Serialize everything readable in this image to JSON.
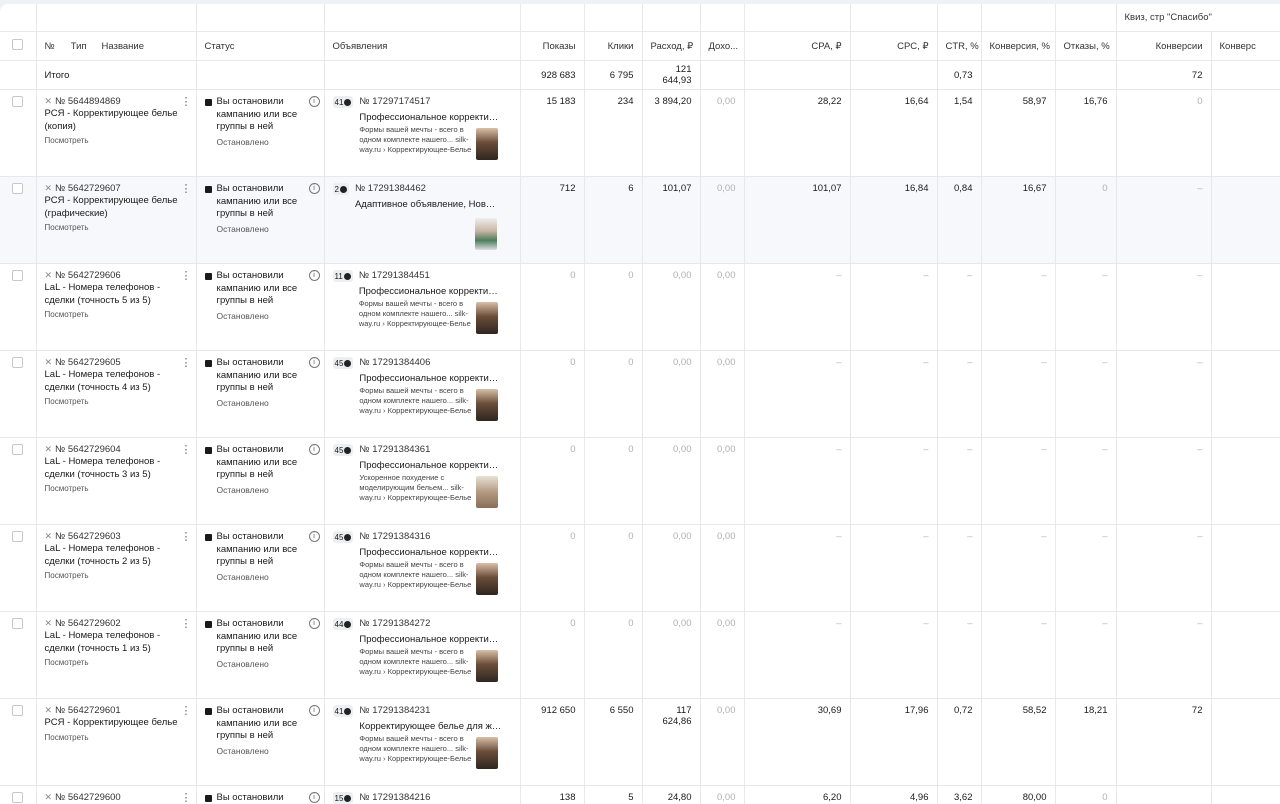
{
  "group_headers": {
    "quiz": "Квиз, стр \"Спасибо\""
  },
  "headers": {
    "num": "№",
    "type": "Тип",
    "name": "Название",
    "status": "Статус",
    "ads": "Объявления",
    "shows": "Показы",
    "clicks": "Клики",
    "spend": "Расход, ₽",
    "income": "Дохо...",
    "cpa": "CPA, ₽",
    "cpc": "CPC, ₽",
    "ctr": "CTR, %",
    "conv_rate": "Конверсия, %",
    "bounce": "Отказы, %",
    "conversions": "Конверсии",
    "conv_rate2": "Конверс"
  },
  "total": {
    "label": "Итого",
    "shows": "928 683",
    "clicks": "6 795",
    "spend": "121 644,93",
    "ctr": "0,73",
    "conversions": "72"
  },
  "link_label": "Посмотреть",
  "rows": [
    {
      "id": "№ 5644894869",
      "name": "РСЯ - Корректирующее белье (копия)",
      "status": "Вы остановили кампанию или все группы в ней",
      "status_sub": "Остановлено",
      "ad_count": "41",
      "ad_id": "№ 17297174517",
      "ad_title": "Профессиональное корректирующее белье",
      "ad_desc": "Формы вашей мечты - всего в одном комплекте нашего... silk-way.ru › Корректирующее-Белье",
      "shows": "15 183",
      "clicks": "234",
      "spend": "3 894,20",
      "income": "0,00",
      "cpa": "28,22",
      "cpc": "16,64",
      "ctr": "1,54",
      "conv": "58,97",
      "bounce": "16,76",
      "conversions": "0"
    },
    {
      "id": "№ 5642729607",
      "name": "РСЯ - Корректирующее белье (графические)",
      "status": "Вы остановили кампанию или все группы в ней",
      "status_sub": "Остановлено",
      "ad_count": "2",
      "ad_id": "№ 17291384462",
      "ad_title": "Адаптивное объявление, Новая графика",
      "ad_desc": "",
      "shows": "712",
      "clicks": "6",
      "spend": "101,07",
      "income": "0,00",
      "cpa": "101,07",
      "cpc": "16,84",
      "ctr": "0,84",
      "conv": "16,67",
      "bounce": "0",
      "conversions": "–"
    },
    {
      "id": "№ 5642729606",
      "name": "LaL - Номера телефонов - сделки (точность 5 из 5)",
      "status": "Вы остановили кампанию или все группы в ней",
      "status_sub": "Остановлено",
      "ad_count": "11",
      "ad_id": "№ 17291384451",
      "ad_title": "Профессиональное корректирующее белье",
      "ad_desc": "Формы вашей мечты - всего в одном комплекте нашего... silk-way.ru › Корректирующее-Белье",
      "shows": "0",
      "clicks": "0",
      "spend": "0,00",
      "income": "0,00",
      "cpa": "–",
      "cpc": "–",
      "ctr": "–",
      "conv": "–",
      "bounce": "–",
      "conversions": "–"
    },
    {
      "id": "№ 5642729605",
      "name": "LaL - Номера телефонов - сделки (точность 4 из 5)",
      "status": "Вы остановили кампанию или все группы в ней",
      "status_sub": "Остановлено",
      "ad_count": "45",
      "ad_id": "№ 17291384406",
      "ad_title": "Профессиональное корректирующее белье",
      "ad_desc": "Формы вашей мечты - всего в одном комплекте нашего... silk-way.ru › Корректирующее-Белье",
      "shows": "0",
      "clicks": "0",
      "spend": "0,00",
      "income": "0,00",
      "cpa": "–",
      "cpc": "–",
      "ctr": "–",
      "conv": "–",
      "bounce": "–",
      "conversions": "–"
    },
    {
      "id": "№ 5642729604",
      "name": "LaL - Номера телефонов - сделки (точность 3 из 5)",
      "status": "Вы остановили кампанию или все группы в ней",
      "status_sub": "Остановлено",
      "ad_count": "45",
      "ad_id": "№ 17291384361",
      "ad_title": "Профессиональное корректирующее белье",
      "ad_desc": "Ускоренное похудение с моделирующим бельем... silk-way.ru › Корректирующее-Белье",
      "shows": "0",
      "clicks": "0",
      "spend": "0,00",
      "income": "0,00",
      "cpa": "–",
      "cpc": "–",
      "ctr": "–",
      "conv": "–",
      "bounce": "–",
      "conversions": "–"
    },
    {
      "id": "№ 5642729603",
      "name": "LaL - Номера телефонов - сделки (точность 2 из 5)",
      "status": "Вы остановили кампанию или все группы в ней",
      "status_sub": "Остановлено",
      "ad_count": "45",
      "ad_id": "№ 17291384316",
      "ad_title": "Профессиональное корректирующее белье",
      "ad_desc": "Формы вашей мечты - всего в одном комплекте нашего... silk-way.ru › Корректирующее-Белье",
      "shows": "0",
      "clicks": "0",
      "spend": "0,00",
      "income": "0,00",
      "cpa": "–",
      "cpc": "–",
      "ctr": "–",
      "conv": "–",
      "bounce": "–",
      "conversions": "–"
    },
    {
      "id": "№ 5642729602",
      "name": "LaL - Номера телефонов - сделки (точность 1 из 5)",
      "status": "Вы остановили кампанию или все группы в ней",
      "status_sub": "Остановлено",
      "ad_count": "44",
      "ad_id": "№ 17291384272",
      "ad_title": "Профессиональное корректирующее белье",
      "ad_desc": "Формы вашей мечты - всего в одном комплекте нашего... silk-way.ru › Корректирующее-Белье",
      "shows": "0",
      "clicks": "0",
      "spend": "0,00",
      "income": "0,00",
      "cpa": "–",
      "cpc": "–",
      "ctr": "–",
      "conv": "–",
      "bounce": "–",
      "conversions": "–"
    },
    {
      "id": "№ 5642729601",
      "name": "РСЯ - Корректирующее белье",
      "status": "Вы остановили кампанию или все группы в ней",
      "status_sub": "Остановлено",
      "ad_count": "41",
      "ad_id": "№ 17291384231",
      "ad_title": "Корректирующее белье для женщин",
      "ad_desc": "Формы вашей мечты - всего в одном комплекте нашего... silk-way.ru › Корректирующее-Белье",
      "shows": "912 650",
      "clicks": "6 550",
      "spend": "117 624,86",
      "income": "0,00",
      "cpa": "30,69",
      "cpc": "17,96",
      "ctr": "0,72",
      "conv": "58,52",
      "bounce": "18,21",
      "conversions": "72"
    },
    {
      "id": "№ 5642729600",
      "name": "",
      "status": "Вы остановили",
      "status_sub": "",
      "ad_count": "15",
      "ad_id": "№ 17291384216",
      "ad_title": "",
      "ad_desc": "",
      "shows": "138",
      "clicks": "5",
      "spend": "24,80",
      "income": "0,00",
      "cpa": "6,20",
      "cpc": "4,96",
      "ctr": "3,62",
      "conv": "80,00",
      "bounce": "0",
      "conversions": ""
    }
  ]
}
